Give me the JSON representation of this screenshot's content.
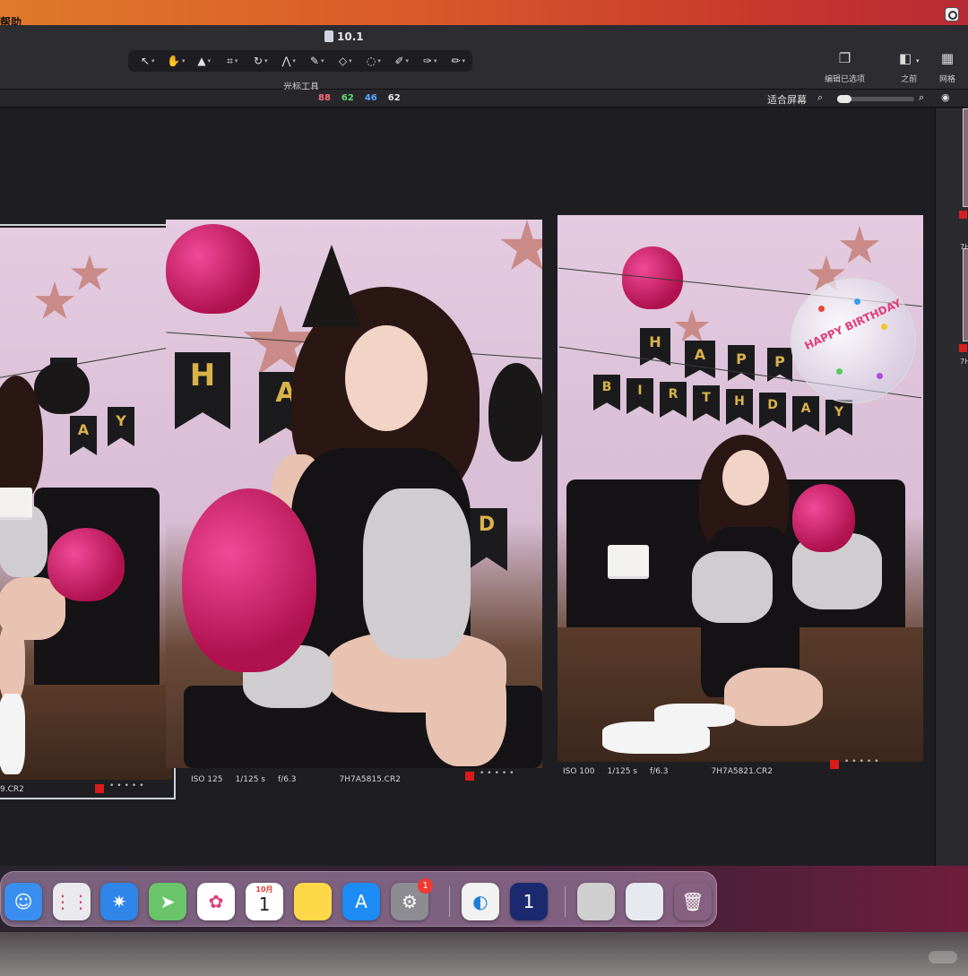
{
  "menubar": {
    "menu_help": "帮助"
  },
  "window": {
    "doc_title": "10.1"
  },
  "toolbar": {
    "tools": [
      {
        "name": "select-tool",
        "glyph": "↖"
      },
      {
        "name": "pan-tool",
        "glyph": "✋"
      },
      {
        "name": "stamp-tool",
        "glyph": "▲"
      },
      {
        "name": "crop-tool",
        "glyph": "⌗"
      },
      {
        "name": "rotate-tool",
        "glyph": "↻"
      },
      {
        "name": "keystone-tool",
        "glyph": "⋀"
      },
      {
        "name": "brush-tool",
        "glyph": "✎"
      },
      {
        "name": "eraser-tool",
        "glyph": "◇"
      },
      {
        "name": "gradient-tool",
        "glyph": "◌"
      },
      {
        "name": "picker-tool",
        "glyph": "✐"
      },
      {
        "name": "pen-tool",
        "glyph": "✑"
      },
      {
        "name": "pencil-tool",
        "glyph": "✏"
      }
    ],
    "caption": "光标工具",
    "edit_selected_label": "编辑已选项",
    "before_label": "之前",
    "grid_label": "网格"
  },
  "subbar": {
    "rgb": [
      "88",
      "62",
      "46",
      "62"
    ],
    "rgb_colors": [
      "#ff6b7a",
      "#5fdc6b",
      "#5aa8ff",
      "#e6e6e6"
    ],
    "fit_label": "适合屏幕"
  },
  "photos": [
    {
      "iso": "",
      "shutter": "",
      "aperture": "",
      "filename": "9.CR2",
      "selected": true
    },
    {
      "iso": "ISO 125",
      "shutter": "1/125 s",
      "aperture": "f/6.3",
      "filename": "7H7A5815.CR2",
      "selected": false
    },
    {
      "iso": "ISO 100",
      "shutter": "1/125 s",
      "aperture": "f/6.3",
      "filename": "7H7A5821.CR2",
      "selected": false
    }
  ],
  "scene": {
    "banner_letters_p1": [
      "Y",
      "A",
      "Y"
    ],
    "banner_letters_p2": [
      "H",
      "A",
      "D"
    ],
    "banner_letters_p3_top": [
      "H",
      "A",
      "P",
      "P"
    ],
    "banner_letters_p3_bottom": [
      "B",
      "I",
      "R",
      "T",
      "H",
      "D",
      "A",
      "Y"
    ],
    "clear_balloon_text": "HAPPY BIRTHDAY"
  },
  "sidebar": {
    "thumb_name_1": "7H"
  },
  "dock": {
    "apps": [
      {
        "name": "finder-icon",
        "glyph": "☺",
        "bg": "#3a8ef0"
      },
      {
        "name": "launchpad-icon",
        "glyph": "⋮⋮",
        "bg": "#e9e9ee"
      },
      {
        "name": "safari-icon",
        "glyph": "✷",
        "bg": "#2f86e8"
      },
      {
        "name": "maps-icon",
        "glyph": "➤",
        "bg": "#6ac56a"
      },
      {
        "name": "photos-icon",
        "glyph": "✿",
        "bg": "#ffffff"
      },
      {
        "name": "calendar-icon",
        "glyph": "",
        "bg": "#ffffff"
      },
      {
        "name": "notes-icon",
        "glyph": "",
        "bg": "#ffd84a"
      },
      {
        "name": "appstore-icon",
        "glyph": "A",
        "bg": "#1e8cf5"
      },
      {
        "name": "settings-icon",
        "glyph": "⚙",
        "bg": "#8c8c92"
      },
      {
        "name": "capture-one-icon",
        "glyph": "◐",
        "bg": "#f2f2f2"
      },
      {
        "name": "one-app-icon",
        "glyph": "1",
        "bg": "#1b2a6e"
      },
      {
        "name": "photo-stack-icon",
        "glyph": "",
        "bg": "#cfcfcf"
      },
      {
        "name": "downloads-icon",
        "glyph": "",
        "bg": "#e6e9f0"
      },
      {
        "name": "trash-icon",
        "glyph": "🗑",
        "bg": "transparent"
      }
    ],
    "calendar_month": "10月",
    "calendar_day": "1",
    "settings_badge": "1"
  }
}
